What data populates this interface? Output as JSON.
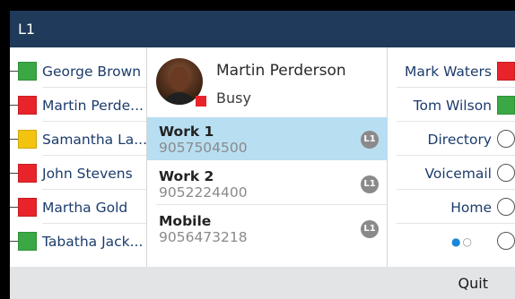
{
  "title": "L1",
  "left_keys": [
    {
      "label": "George Brown",
      "color": "#3aa845"
    },
    {
      "label": "Martin Perde...",
      "color": "#e8242a"
    },
    {
      "label": "Samantha La...",
      "color": "#f2c40f"
    },
    {
      "label": "John Stevens",
      "color": "#e8242a"
    },
    {
      "label": "Martha Gold",
      "color": "#e8242a"
    },
    {
      "label": "Tabatha Jack...",
      "color": "#3aa845"
    }
  ],
  "contact": {
    "name": "Martin Perderson",
    "status": "Busy",
    "presence_color": "#e8242a"
  },
  "numbers": [
    {
      "type": "Work 1",
      "number": "9057504500",
      "line": "L1",
      "selected": true
    },
    {
      "type": "Work 2",
      "number": "9052224400",
      "line": "L1",
      "selected": false
    },
    {
      "type": "Mobile",
      "number": "9056473218",
      "line": "L1",
      "selected": false
    }
  ],
  "right_keys": [
    {
      "label": "Mark Waters",
      "indicator": "square",
      "color": "#e8242a"
    },
    {
      "label": "Tom Wilson",
      "indicator": "square",
      "color": "#3aa845"
    },
    {
      "label": "Directory",
      "indicator": "circle"
    },
    {
      "label": "Voicemail",
      "indicator": "circle"
    },
    {
      "label": "Home",
      "indicator": "circle"
    }
  ],
  "page_dots": {
    "current": 1,
    "total": 2
  },
  "softkeys": {
    "quit": "Quit"
  },
  "colors": {
    "titlebar": "#1f3a5a",
    "selection": "#b8def2",
    "label_text": "#1c3c6c"
  }
}
